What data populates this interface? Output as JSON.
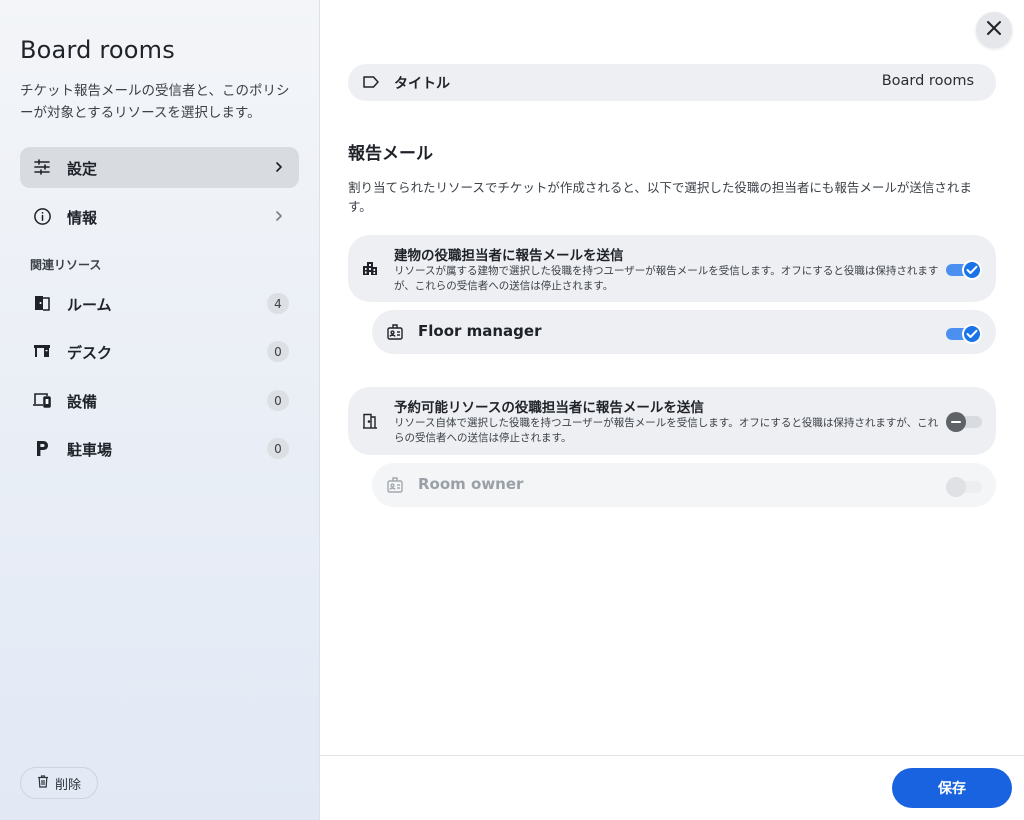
{
  "sidebar": {
    "title": "Board rooms",
    "description": "チケット報告メールの受信者と、このポリシーが対象とするリソースを選択します。",
    "nav": [
      {
        "label": "設定",
        "icon": "sliders-icon",
        "active": true
      },
      {
        "label": "情報",
        "icon": "info-icon",
        "active": false
      }
    ],
    "related_label": "関連リソース",
    "resources": [
      {
        "label": "ルーム",
        "icon": "door-icon",
        "count": "4"
      },
      {
        "label": "デスク",
        "icon": "desk-icon",
        "count": "0"
      },
      {
        "label": "設備",
        "icon": "devices-icon",
        "count": "0"
      },
      {
        "label": "駐車場",
        "icon": "parking-icon",
        "count": "0"
      }
    ],
    "delete_label": "削除"
  },
  "main": {
    "title_field": {
      "label": "タイトル",
      "value": "Board rooms"
    },
    "section_title": "報告メール",
    "section_description": "割り当てられたリソースでチケットが作成されると、以下で選択した役職の担当者にも報告メールが送信されます。",
    "cards": [
      {
        "title": "建物の役職担当者に報告メールを送信",
        "description": "リソースが属する建物で選択した役職を持つユーザーが報告メールを受信します。オフにすると役職は保持されますが、これらの受信者への送信は停止されます。",
        "icon": "building-icon",
        "enabled": true,
        "roles": [
          {
            "label": "Floor manager",
            "icon": "badge-icon",
            "enabled": true,
            "disabled": false
          }
        ]
      },
      {
        "title": "予約可能リソースの役職担当者に報告メールを送信",
        "description": "リソース自体で選択した役職を持つユーザーが報告メールを受信します。オフにすると役職は保持されますが、これらの受信者への送信は停止されます。",
        "icon": "room-door-icon",
        "enabled": false,
        "roles": [
          {
            "label": "Room owner",
            "icon": "badge-icon",
            "enabled": false,
            "disabled": true
          }
        ]
      }
    ],
    "save_label": "保存"
  },
  "colors": {
    "accent": "#1a63e0",
    "toggle_on": "#1a73e8",
    "card_bg": "#edeff2",
    "active_nav_bg": "#d8dce1"
  }
}
